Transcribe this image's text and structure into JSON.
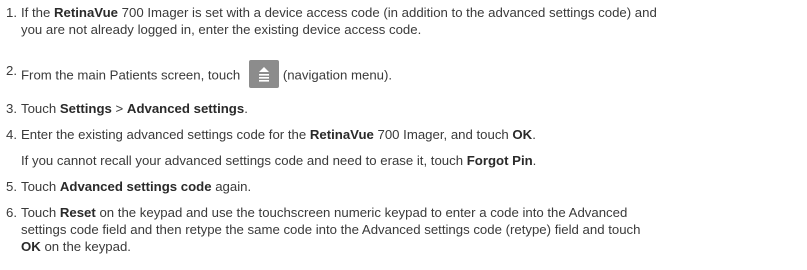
{
  "steps": [
    {
      "num": "1.",
      "parts": [
        "If the ",
        "RetinaVue",
        " 700 Imager is set with a device access code (in addition to the advanced settings code) and",
        "you are not already logged in, enter the existing device access code."
      ]
    },
    {
      "num": "2.",
      "parts": [
        "From the main Patients screen, touch ",
        "(navigation menu)."
      ],
      "icon": "navigation-menu-icon"
    },
    {
      "num": "3.",
      "parts": [
        "Touch ",
        "Settings",
        " > ",
        "Advanced settings",
        "."
      ]
    },
    {
      "num": "4.",
      "parts": [
        "Enter the existing advanced settings code for the ",
        "RetinaVue",
        " 700 Imager, and touch ",
        "OK",
        "."
      ]
    },
    {
      "note_parts": [
        "If you cannot recall your advanced settings code and need to erase it, touch ",
        "Forgot Pin",
        "."
      ]
    },
    {
      "num": "5.",
      "parts": [
        "Touch ",
        "Advanced settings code",
        " again."
      ]
    },
    {
      "num": "6.",
      "parts": [
        "Touch ",
        "Reset",
        " on the keypad and use the touchscreen numeric keypad to enter a code into the Advanced",
        "settings code field and then retype the same code into the Advanced settings code (retype) field and touch",
        "OK",
        " on the keypad."
      ]
    }
  ],
  "colors": {
    "text": "#3a3a3a",
    "icon_bg": "#8c8c8c"
  }
}
